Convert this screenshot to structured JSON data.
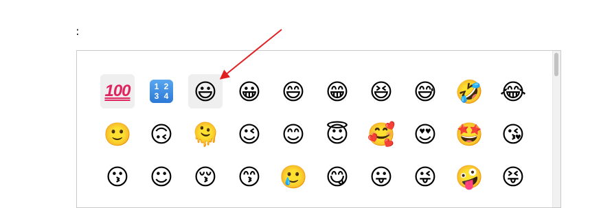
{
  "header": {
    "colon": ":"
  },
  "picker": {
    "rows": [
      [
        {
          "name": "emoji-hundred-points",
          "glyph": "100",
          "kind": "hundred",
          "hl": true
        },
        {
          "name": "emoji-input-numbers",
          "glyph": "1234",
          "kind": "numbers",
          "hl": false
        },
        {
          "name": "emoji-grinning-face-big-eyes",
          "glyph": "😃",
          "kind": "face",
          "hl": true
        },
        {
          "name": "emoji-grinning-face",
          "glyph": "😀",
          "kind": "face",
          "hl": false
        },
        {
          "name": "emoji-grinning-face-smiling-eyes",
          "glyph": "😄",
          "kind": "face",
          "hl": false
        },
        {
          "name": "emoji-beaming-face",
          "glyph": "😁",
          "kind": "face",
          "hl": false
        },
        {
          "name": "emoji-grinning-squinting-face",
          "glyph": "😆",
          "kind": "face",
          "hl": false
        },
        {
          "name": "emoji-grinning-face-sweat",
          "glyph": "😅",
          "kind": "face",
          "hl": false
        },
        {
          "name": "emoji-rolling-on-floor-laughing",
          "glyph": "🤣",
          "kind": "face",
          "hl": false
        },
        {
          "name": "emoji-face-tears-of-joy",
          "glyph": "😂",
          "kind": "face",
          "hl": false
        }
      ],
      [
        {
          "name": "emoji-slightly-smiling-face",
          "glyph": "🙂",
          "kind": "face",
          "hl": false
        },
        {
          "name": "emoji-upside-down-face",
          "glyph": "🙃",
          "kind": "face",
          "hl": false
        },
        {
          "name": "emoji-melting-face",
          "glyph": "🫠",
          "kind": "face",
          "hl": false
        },
        {
          "name": "emoji-winking-face",
          "glyph": "😉",
          "kind": "face",
          "hl": false
        },
        {
          "name": "emoji-smiling-face-smiling-eyes",
          "glyph": "😊",
          "kind": "face",
          "hl": false
        },
        {
          "name": "emoji-smiling-face-halo",
          "glyph": "😇",
          "kind": "face",
          "hl": false
        },
        {
          "name": "emoji-smiling-face-hearts",
          "glyph": "🥰",
          "kind": "face",
          "hl": false
        },
        {
          "name": "emoji-heart-eyes",
          "glyph": "😍",
          "kind": "face",
          "hl": false
        },
        {
          "name": "emoji-star-struck",
          "glyph": "🤩",
          "kind": "face",
          "hl": false
        },
        {
          "name": "emoji-face-blowing-kiss",
          "glyph": "😘",
          "kind": "face",
          "hl": false
        }
      ],
      [
        {
          "name": "emoji-kissing-face",
          "glyph": "😗",
          "kind": "face",
          "hl": false
        },
        {
          "name": "emoji-smiling-face",
          "glyph": "☺",
          "kind": "face",
          "hl": false
        },
        {
          "name": "emoji-kissing-face-closed-eyes",
          "glyph": "😚",
          "kind": "face",
          "hl": false
        },
        {
          "name": "emoji-kissing-face-smiling-eyes",
          "glyph": "😙",
          "kind": "face",
          "hl": false
        },
        {
          "name": "emoji-smiling-face-tear",
          "glyph": "🥲",
          "kind": "face",
          "hl": false
        },
        {
          "name": "emoji-face-savoring-food",
          "glyph": "😋",
          "kind": "face",
          "hl": false
        },
        {
          "name": "emoji-face-with-tongue",
          "glyph": "😛",
          "kind": "face",
          "hl": false
        },
        {
          "name": "emoji-winking-face-tongue",
          "glyph": "😜",
          "kind": "face",
          "hl": false
        },
        {
          "name": "emoji-zany-face",
          "glyph": "🤪",
          "kind": "face",
          "hl": false
        },
        {
          "name": "emoji-squinting-face-tongue",
          "glyph": "😝",
          "kind": "face",
          "hl": false
        }
      ]
    ]
  },
  "annotation": {
    "arrow_color": "#e02020"
  }
}
